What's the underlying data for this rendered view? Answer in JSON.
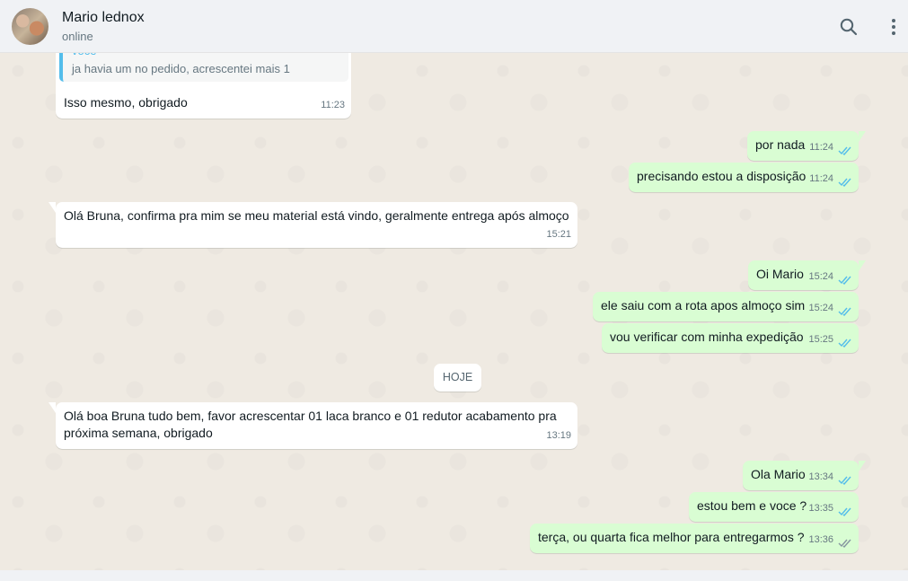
{
  "header": {
    "contact_name": "Mario lednox",
    "status": "online",
    "search_icon": "search-icon",
    "menu_icon": "more-vertical-icon"
  },
  "colors": {
    "outgoing_bubble": "#d9fdd3",
    "incoming_bubble": "#ffffff",
    "read_tick": "#53bdeb",
    "quote_accent": "#53bdeb"
  },
  "quote": {
    "author": "voce",
    "text": "ja havia um no pedido, acrescentei mais 1"
  },
  "messages": [
    {
      "text": "Isso mesmo, obrigado",
      "time": "11:23"
    },
    {
      "text": "por nada",
      "time": "11:24"
    },
    {
      "text": "precisando estou a disposição",
      "time": "11:24"
    },
    {
      "text": "Olá Bruna, confirma pra mim se meu material está vindo, geralmente entrega após almoço",
      "time": "15:21"
    },
    {
      "text": "Oi Mario",
      "time": "15:24"
    },
    {
      "text": "ele saiu com a rota apos almoço sim",
      "time": "15:24"
    },
    {
      "text": "vou verificar com minha expedição",
      "time": "15:25"
    },
    {
      "text": "Olá boa Bruna tudo bem,  favor acrescentar 01 laca branco e 01 redutor acabamento pra",
      "text2": "próxima semana, obrigado",
      "time": "13:19"
    },
    {
      "text": "Ola Mario",
      "time": "13:34"
    },
    {
      "text": "estou bem e voce ?",
      "time": "13:35"
    },
    {
      "text": "terça, ou quarta fica melhor para entregarmos ?",
      "time": "13:36"
    }
  ],
  "day_divider": "HOJE"
}
